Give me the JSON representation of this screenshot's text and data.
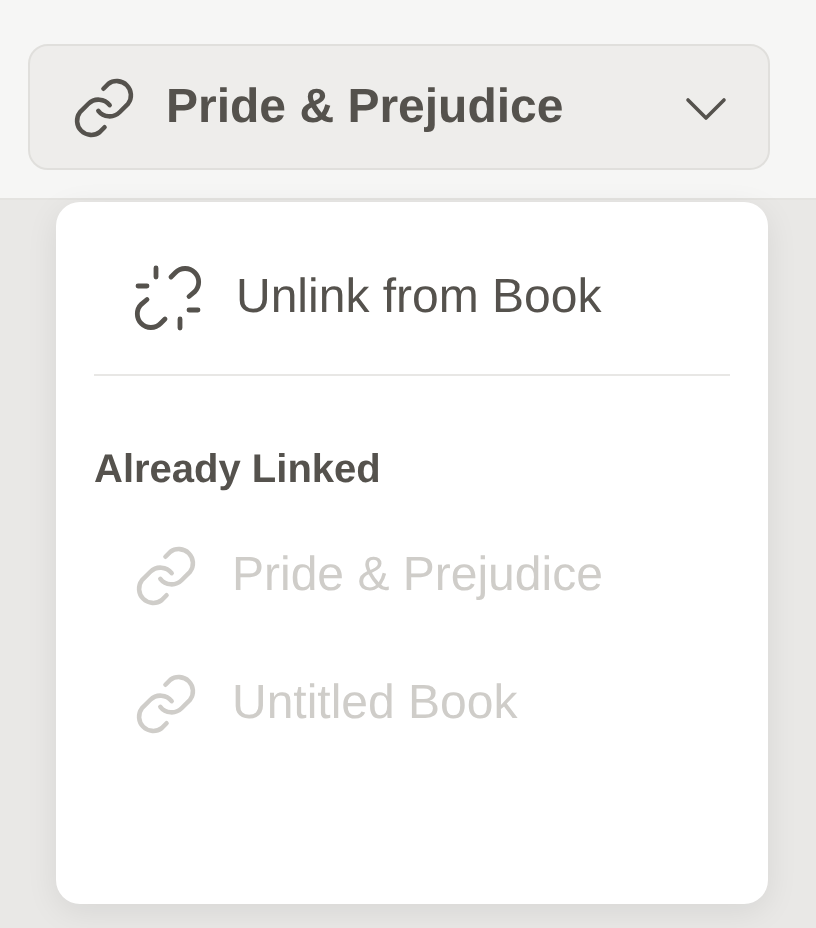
{
  "book_button": {
    "label": "Pride & Prejudice"
  },
  "menu": {
    "unlink": {
      "label": "Unlink from Book",
      "disabled": false
    },
    "section_title": "Already Linked",
    "items": [
      {
        "label": "Pride & Prejudice",
        "disabled": true
      },
      {
        "label": "Untitled Book",
        "disabled": true
      }
    ]
  }
}
